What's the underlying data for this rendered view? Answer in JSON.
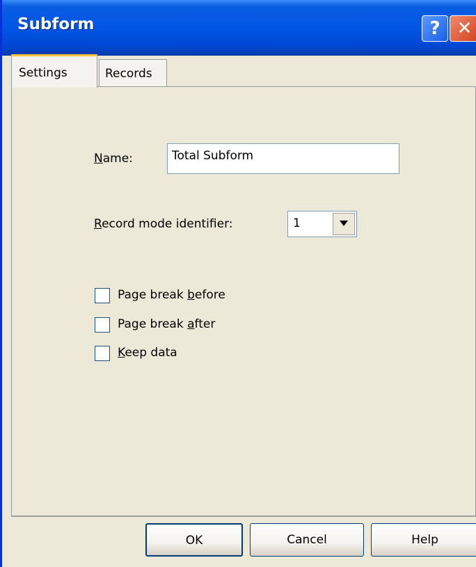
{
  "window": {
    "title": "Subform",
    "help_glyph": "?",
    "close_glyph": "✕"
  },
  "tabs": [
    {
      "label": "Settings",
      "selected": true
    },
    {
      "label": "Records",
      "selected": false
    }
  ],
  "settings": {
    "name_label_accel": "N",
    "name_label_rest": "ame:",
    "name_value": "Total Subform",
    "record_mode_label_accel": "R",
    "record_mode_label_rest": "ecord mode identifier:",
    "record_mode_value": "1",
    "checkboxes": [
      {
        "pre": "Page break ",
        "accel": "b",
        "post": "efore",
        "checked": false
      },
      {
        "pre": "Page break ",
        "accel": "a",
        "post": "fter",
        "checked": false
      },
      {
        "pre": "",
        "accel": "K",
        "post": "eep data",
        "checked": false
      }
    ]
  },
  "buttons": {
    "ok": "OK",
    "cancel": "Cancel",
    "help": "Help"
  },
  "icons": {
    "dropdown": "chevron-down-icon"
  }
}
